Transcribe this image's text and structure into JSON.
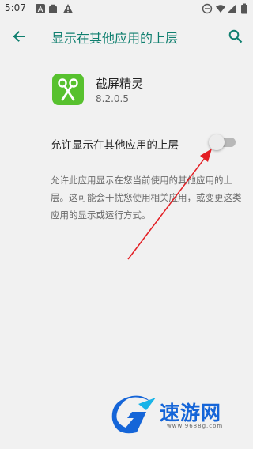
{
  "status_bar": {
    "time": "5:07",
    "icons": [
      "a-icon",
      "bag-icon",
      "warning-icon",
      "minus-circle-icon",
      "wifi-icon",
      "signal-icon",
      "battery-icon"
    ]
  },
  "app_bar": {
    "title": "显示在其他应用的上层",
    "back_icon": "back-arrow-icon",
    "search_icon": "search-icon"
  },
  "app": {
    "name": "截屏精灵",
    "version": "8.2.0.5",
    "icon": "scissors-icon",
    "icon_color": "#57c12e"
  },
  "permission": {
    "label": "允许显示在其他应用的上层",
    "enabled": false,
    "description": "允许此应用显示在您当前使用的其他应用的上层。这可能会干扰您使用相关应用，或变更这类应用的显示或运行方式。"
  },
  "watermark": {
    "text": "速游网",
    "url": "www.9688g.com"
  },
  "colors": {
    "accent": "#0f7f6f",
    "annotation_arrow": "#e31e24",
    "watermark": "#1565d8"
  }
}
